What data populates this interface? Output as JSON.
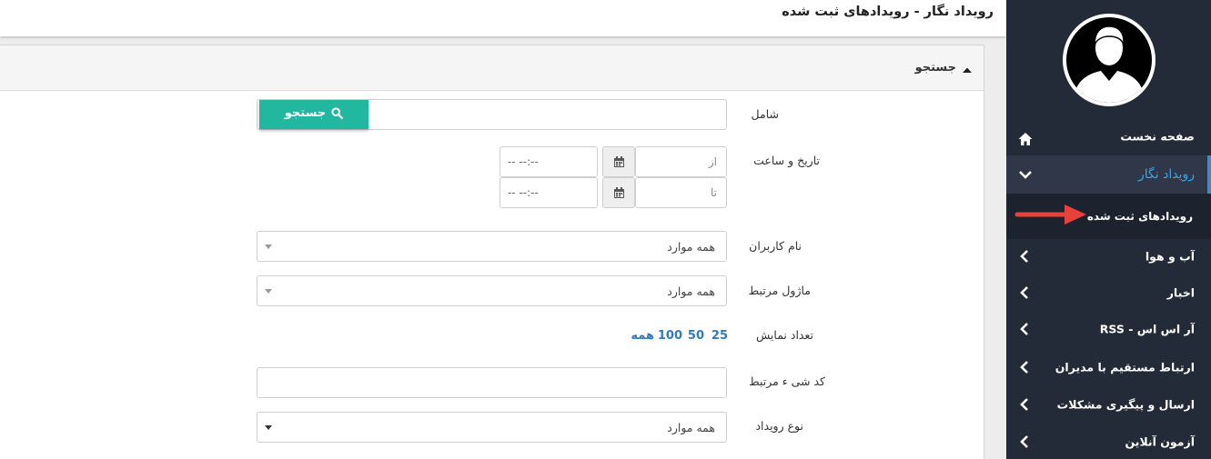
{
  "header": {
    "title": "رویداد نگار - رویدادهای ثبت شده"
  },
  "sidebar": {
    "items": [
      {
        "label": "صفحه نخست",
        "icon": "home-icon"
      },
      {
        "label": "رویداد نگار",
        "icon": "chevron-down-icon",
        "active": true
      },
      {
        "label": "رویدادهای ثبت شده",
        "sub": true
      },
      {
        "label": "آب و هوا",
        "icon": "chevron-left-icon"
      },
      {
        "label": "اخبار",
        "icon": "chevron-left-icon"
      },
      {
        "label": "آر اس اس - RSS",
        "icon": "chevron-left-icon"
      },
      {
        "label": "ارتباط مستقیم با مدیران",
        "icon": "chevron-left-icon"
      },
      {
        "label": "ارسال و پیگیری مشکلات",
        "icon": "chevron-left-icon"
      },
      {
        "label": "آزمون آنلاین",
        "icon": "chevron-left-icon"
      }
    ]
  },
  "search_panel": {
    "title": "جستجو",
    "contains": {
      "label": "شامل",
      "value": "",
      "button_label": "جستجو"
    },
    "datetime": {
      "label": "تاریخ و ساعت",
      "from_placeholder": "از",
      "to_placeholder": "تا",
      "from_time_placeholder": "-- --:--",
      "to_time_placeholder": "-- --:--"
    },
    "users": {
      "label": "نام کاربران",
      "value": "همه موارد"
    },
    "module": {
      "label": "ماژول مرتبط",
      "value": "همه موارد"
    },
    "page_size": {
      "label": "تعداد نمایش",
      "options": [
        "25",
        "50",
        "100",
        "همه"
      ]
    },
    "object_code": {
      "label": "کد شی ء مرتبط",
      "value": ""
    },
    "event_type": {
      "label": "نوع رویداد",
      "value": "همه موارد"
    }
  },
  "colors": {
    "sidebar_bg": "#232a38",
    "accent": "#2a93d6",
    "button": "#22b79f",
    "annotation_arrow": "#e8413a"
  }
}
